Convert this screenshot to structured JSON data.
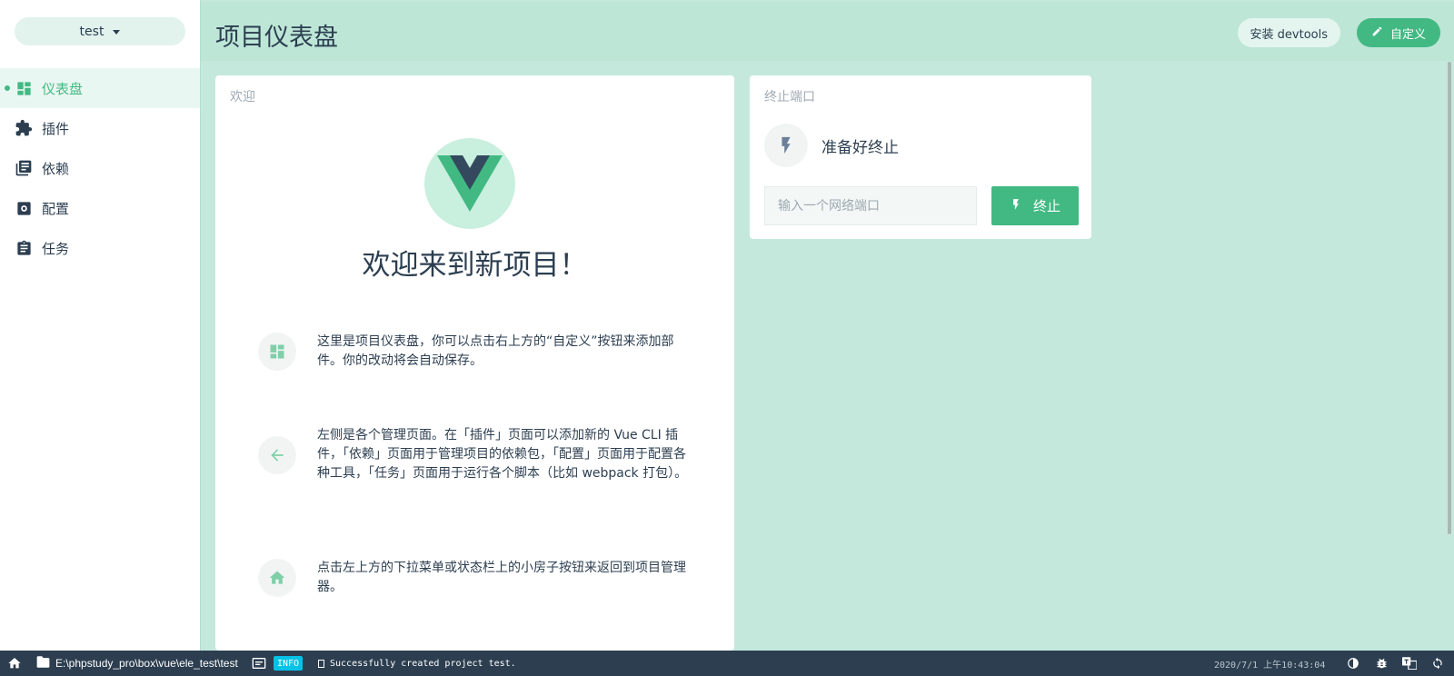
{
  "sidebar": {
    "project": "test",
    "items": [
      {
        "label": "仪表盘",
        "icon": "dashboard-icon",
        "active": true
      },
      {
        "label": "插件",
        "icon": "puzzle-icon"
      },
      {
        "label": "依赖",
        "icon": "library-books-icon"
      },
      {
        "label": "配置",
        "icon": "settings-box-icon"
      },
      {
        "label": "任务",
        "icon": "clipboard-icon"
      }
    ]
  },
  "header": {
    "title": "项目仪表盘",
    "devtools_label": "安装 devtools",
    "customize_label": "自定义"
  },
  "welcome": {
    "card_title": "欢迎",
    "heading": "欢迎来到新项目！",
    "tips": [
      {
        "icon": "dashboard-icon",
        "text": "这里是项目仪表盘，你可以点击右上方的“自定义”按钮来添加部件。你的改动将会自动保存。"
      },
      {
        "icon": "arrow-left-icon",
        "text": "左侧是各个管理页面。在「插件」页面可以添加新的 Vue CLI 插件，「依赖」页面用于管理项目的依赖包，「配置」页面用于配置各种工具，「任务」页面用于运行各个脚本（比如 webpack 打包）。"
      },
      {
        "icon": "home-icon",
        "text": "点击左上方的下拉菜单或状态栏上的小房子按钮来返回到项目管理器。"
      }
    ]
  },
  "kill_port": {
    "card_title": "终止端口",
    "status": "准备好终止",
    "input_placeholder": "输入一个网络端口",
    "button_label": "终止"
  },
  "statusbar": {
    "path": "E:\\phpstudy_pro\\box\\vue\\ele_test\\test",
    "badge": "INFO",
    "log": "Successfully created project test.",
    "time": "2020/7/1 上午10:43:04"
  },
  "colors": {
    "accent": "#42b983",
    "dark": "#2c3e50",
    "main_bg": "#c4e9dc",
    "info_badge": "#03c2e6"
  }
}
